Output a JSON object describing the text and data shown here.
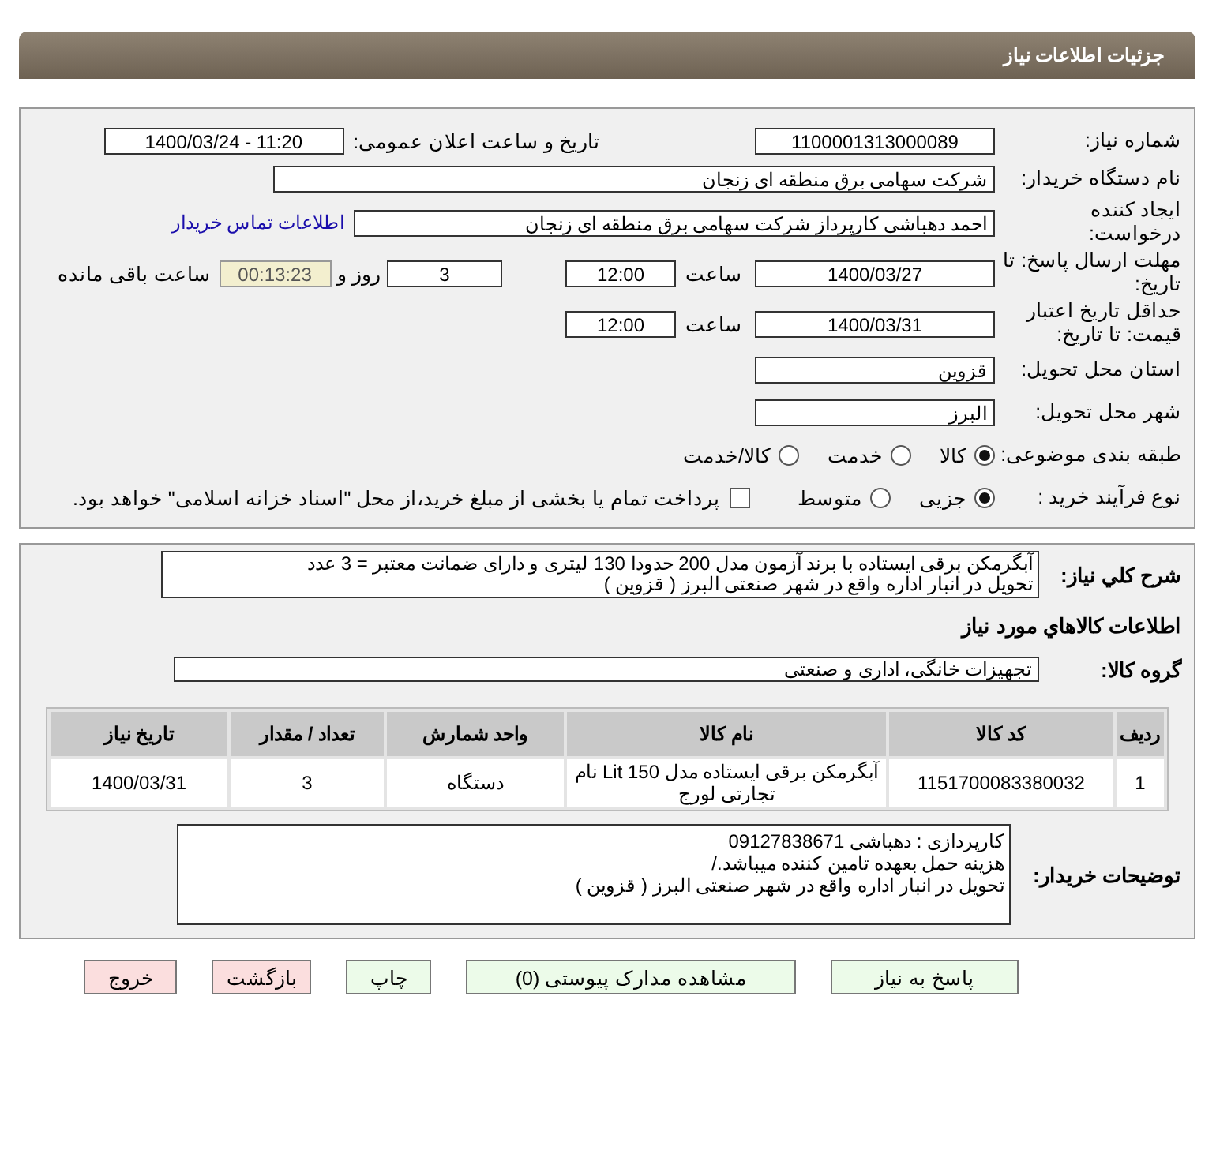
{
  "header": {
    "title": "جزئیات اطلاعات نیاز"
  },
  "need_number": {
    "label": "شماره نیاز:",
    "value": "1100001313000089"
  },
  "announce": {
    "label": "تاریخ و ساعت اعلان عمومی:",
    "value": "1400/03/24 - 11:20"
  },
  "buyer": {
    "label": "نام دستگاه خریدار:",
    "value": "شرکت سهامی برق منطقه ای زنجان"
  },
  "requester": {
    "label": "ایجاد کننده درخواست:",
    "value": "احمد دهباشی کارپرداز شرکت سهامی برق منطقه ای زنجان",
    "link": "اطلاعات تماس خریدار"
  },
  "reply_deadline": {
    "label": "مهلت ارسال پاسخ: تا تاریخ:",
    "date": "1400/03/27",
    "time_label": "ساعت",
    "time": "12:00",
    "days": "3",
    "days_label": "روز و",
    "remaining": "00:13:23",
    "remaining_label": "ساعت باقی مانده"
  },
  "price_validity": {
    "label": "حداقل تاریخ اعتبار قیمت: تا تاریخ:",
    "date": "1400/03/31",
    "time_label": "ساعت",
    "time": "12:00"
  },
  "province": {
    "label": "استان محل تحویل:",
    "value": "قزوین"
  },
  "city": {
    "label": "شهر محل تحویل:",
    "value": "البرز"
  },
  "category": {
    "label": "طبقه بندی موضوعی:",
    "options": [
      {
        "label": "کالا",
        "selected": true
      },
      {
        "label": "خدمت",
        "selected": false
      },
      {
        "label": "کالا/خدمت",
        "selected": false
      }
    ]
  },
  "purchase_type": {
    "label": "نوع فرآیند خرید :",
    "options": [
      {
        "label": "جزیی",
        "selected": true
      },
      {
        "label": "متوسط",
        "selected": false
      }
    ],
    "payment_note": {
      "label": "پرداخت تمام یا بخشی از مبلغ خرید،از محل \"اسناد خزانه اسلامی\" خواهد بود.",
      "checked": false
    }
  },
  "description": {
    "label": "شرح کلي نیاز:",
    "lines": [
      "آبگرمکن برقی ایستاده با برند آزمون مدل  200 حدودا 130  لیتری و دارای ضمانت معتبر = 3 عدد",
      "تحویل در انبار اداره واقع در شهر صنعتی البرز ( قزوین )"
    ]
  },
  "goods_title": "اطلاعات کالاهاي مورد نياز",
  "goods_group": {
    "label": "گروه کالا:",
    "value": "تجهیزات خانگی، اداری و صنعتی"
  },
  "table": {
    "columns": [
      "ردیف",
      "کد کالا",
      "نام کالا",
      "واحد شمارش",
      "تعداد / مقدار",
      "تاریخ نیاز"
    ],
    "rows": [
      [
        "1",
        "1151700083380032",
        "آبگرمکن برقی ایستاده مدل Lit 150 نام تجارتی لورج",
        "دستگاه",
        "3",
        "1400/03/31"
      ]
    ]
  },
  "buyer_notes": {
    "label": "توضیحات خریدار:",
    "lines": [
      "کارپردازی : دهباشی 09127838671",
      "هزینه حمل بعهده تامین کننده میباشد./",
      "تحویل در انبار اداره واقع در شهر صنعتی البرز ( قزوین )"
    ]
  },
  "buttons": [
    {
      "label": "پاسخ به نیاز",
      "kind": "normal"
    },
    {
      "label": "مشاهده مدارک پیوستی (0)",
      "kind": "normal"
    },
    {
      "label": "چاپ",
      "kind": "normal"
    },
    {
      "label": "بازگشت",
      "kind": "danger"
    },
    {
      "label": "خروج",
      "kind": "danger"
    }
  ]
}
